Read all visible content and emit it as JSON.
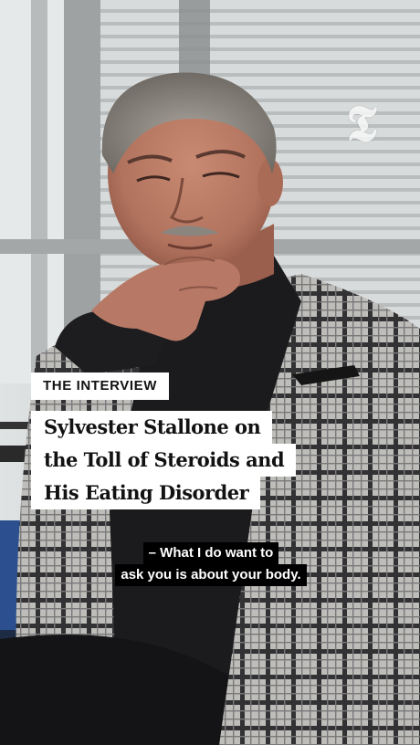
{
  "video": {
    "publisher_logo": "nyt-t-logo",
    "logo_glyph": "𝕿"
  },
  "overlay": {
    "tag": "THE INTERVIEW",
    "headline_lines": [
      "Sylvester Stallone on",
      "the Toll of Steroids and",
      "His Eating Disorder"
    ]
  },
  "caption": {
    "lines": [
      "– What I do want to",
      "ask you is about your body."
    ]
  }
}
